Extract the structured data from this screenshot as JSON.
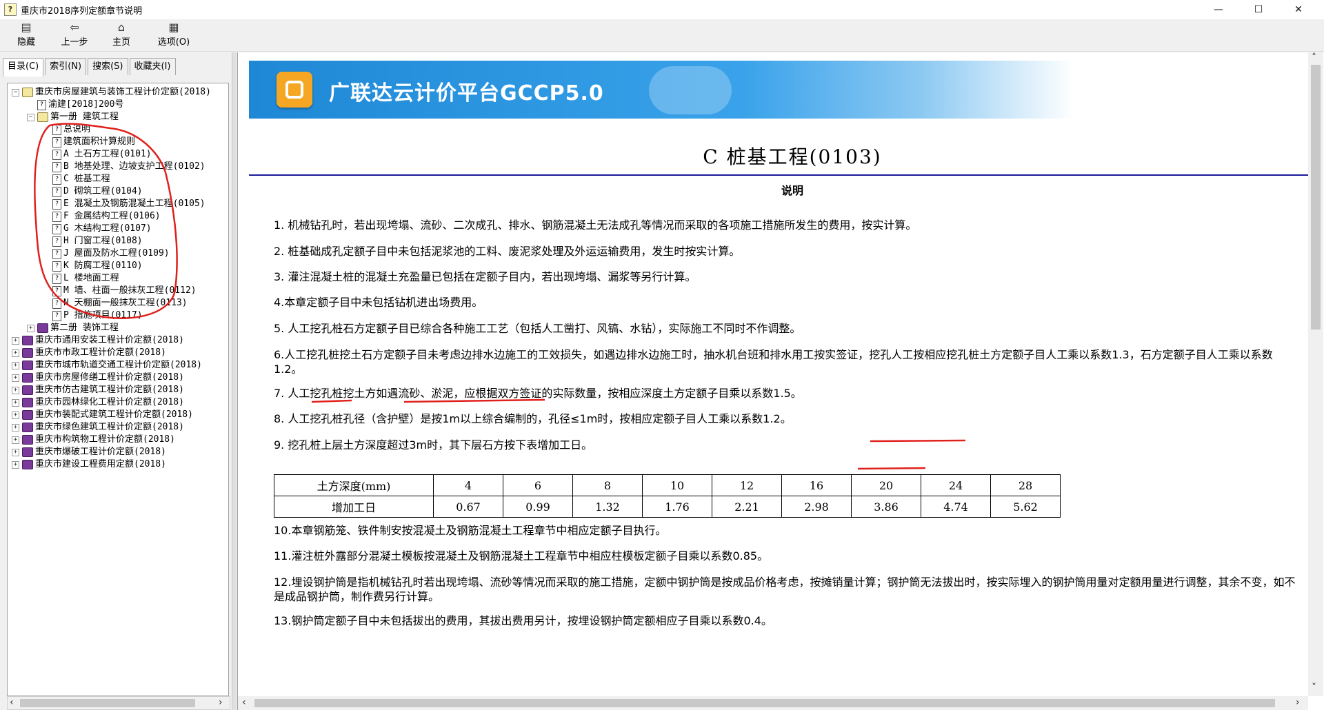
{
  "window": {
    "title": "重庆市2018序列定额章节说明",
    "controls": {
      "minimize": "—",
      "maximize": "☐",
      "close": "✕"
    }
  },
  "toolbar": {
    "hide": "隐藏",
    "back": "上一步",
    "home": "主页",
    "options": "选项(O)"
  },
  "left_tabs": [
    "目录(C)",
    "索引(N)",
    "搜索(S)",
    "收藏夹(I)"
  ],
  "tree": [
    {
      "level": 0,
      "icon": "book-open",
      "expander": "⊟",
      "label": "重庆市房屋建筑与装饰工程计价定额(2018)"
    },
    {
      "level": 1,
      "icon": "page",
      "label": "渝建[2018]200号"
    },
    {
      "level": 1,
      "icon": "book-open",
      "expander": "⊟",
      "label": "第一册 建筑工程"
    },
    {
      "level": 2,
      "icon": "page",
      "label": "总说明"
    },
    {
      "level": 2,
      "icon": "page",
      "label": "建筑面积计算规则"
    },
    {
      "level": 2,
      "icon": "page",
      "label": "A 土石方工程(0101)"
    },
    {
      "level": 2,
      "icon": "page",
      "label": "B 地基处理、边坡支护工程(0102)"
    },
    {
      "level": 2,
      "icon": "page",
      "label": "C 桩基工程"
    },
    {
      "level": 2,
      "icon": "page",
      "label": "D 砌筑工程(0104)"
    },
    {
      "level": 2,
      "icon": "page",
      "label": "E 混凝土及钢筋混凝土工程(0105)"
    },
    {
      "level": 2,
      "icon": "page",
      "label": "F 金属结构工程(0106)"
    },
    {
      "level": 2,
      "icon": "page",
      "label": "G 木结构工程(0107)"
    },
    {
      "level": 2,
      "icon": "page",
      "label": "H 门窗工程(0108)"
    },
    {
      "level": 2,
      "icon": "page",
      "label": "J 屋面及防水工程(0109)"
    },
    {
      "level": 2,
      "icon": "page",
      "label": "K 防腐工程(0110)"
    },
    {
      "level": 2,
      "icon": "page",
      "label": "L 楼地面工程"
    },
    {
      "level": 2,
      "icon": "page",
      "label": "M 墙、柱面一般抹灰工程(0112)"
    },
    {
      "level": 2,
      "icon": "page",
      "label": "N 天棚面一般抹灰工程(0113)"
    },
    {
      "level": 2,
      "icon": "page",
      "label": "P 措施项目(0117)"
    },
    {
      "level": 1,
      "icon": "book",
      "expander": "⊞",
      "label": "第二册 装饰工程"
    },
    {
      "level": 0,
      "icon": "book",
      "expander": "⊞",
      "label": "重庆市通用安装工程计价定额(2018)"
    },
    {
      "level": 0,
      "icon": "book",
      "expander": "⊞",
      "label": "重庆市市政工程计价定额(2018)"
    },
    {
      "level": 0,
      "icon": "book",
      "expander": "⊞",
      "label": "重庆市城市轨道交通工程计价定额(2018)"
    },
    {
      "level": 0,
      "icon": "book",
      "expander": "⊞",
      "label": "重庆市房屋修缮工程计价定额(2018)"
    },
    {
      "level": 0,
      "icon": "book",
      "expander": "⊞",
      "label": "重庆市仿古建筑工程计价定额(2018)"
    },
    {
      "level": 0,
      "icon": "book",
      "expander": "⊞",
      "label": "重庆市园林绿化工程计价定额(2018)"
    },
    {
      "level": 0,
      "icon": "book",
      "expander": "⊞",
      "label": "重庆市装配式建筑工程计价定额(2018)"
    },
    {
      "level": 0,
      "icon": "book",
      "expander": "⊞",
      "label": "重庆市绿色建筑工程计价定额(2018)"
    },
    {
      "level": 0,
      "icon": "book",
      "expander": "⊞",
      "label": "重庆市构筑物工程计价定额(2018)"
    },
    {
      "level": 0,
      "icon": "book",
      "expander": "⊞",
      "label": "重庆市爆破工程计价定额(2018)"
    },
    {
      "level": 0,
      "icon": "book",
      "expander": "⊞",
      "label": "重庆市建设工程费用定额(2018)"
    }
  ],
  "content": {
    "banner_text": "广联达云计价平台GCCP5.0",
    "title": "C 桩基工程(0103)",
    "subtitle": "说明",
    "paragraphs": [
      "1. 机械钻孔时，若出现垮塌、流砂、二次成孔、排水、钢筋混凝土无法成孔等情况而采取的各项施工措施所发生的费用，按实计算。",
      "2. 桩基础成孔定额子目中未包括泥浆池的工料、废泥浆处理及外运运输费用，发生时按实计算。",
      "3. 灌注混凝土桩的混凝土充盈量已包括在定额子目内，若出现垮塌、漏浆等另行计算。",
      "4.本章定额子目中未包括钻机进出场费用。",
      "5. 人工挖孔桩石方定额子目已综合各种施工工艺（包括人工凿打、风镐、水钻），实际施工不同时不作调整。",
      "6.人工挖孔桩挖土石方定额子目未考虑边排水边施工的工效损失，如遇边排水边施工时，抽水机台班和排水用工按实签证，挖孔人工按相应挖孔桩土方定额子目人工乘以系数1.3，石方定额子目人工乘以系数1.2。",
      "7. 人工挖孔桩挖土方如遇流砂、淤泥，应根据双方签证的实际数量，按相应深度土方定额子目乘以系数1.5。",
      "8. 人工挖孔桩孔径（含护壁）是按1m以上综合编制的，孔径≤1m时，按相应定额子目人工乘以系数1.2。",
      "9. 挖孔桩上层土方深度超过3m时，其下层石方按下表增加工日。",
      "10.本章钢筋笼、铁件制安按混凝土及钢筋混凝土工程章节中相应定额子目执行。",
      "11.灌注桩外露部分混凝土模板按混凝土及钢筋混凝土工程章节中相应柱模板定额子目乘以系数0.85。",
      "12.埋设钢护筒是指机械钻孔时若出现垮塌、流砂等情况而采取的施工措施，定额中钢护筒是按成品价格考虑，按摊销量计算；钢护筒无法拔出时，按实际埋入的钢护筒用量对定额用量进行调整，其余不变，如不是成品钢护筒，制作费另行计算。",
      "13.钢护筒定额子目中未包括拔出的费用，其拔出费用另计，按埋设钢护筒定额相应子目乘以系数0.4。"
    ],
    "table": {
      "header_label": "土方深度(mm)",
      "depths": [
        "4",
        "6",
        "8",
        "10",
        "12",
        "16",
        "20",
        "24",
        "28"
      ],
      "row_label": "增加工日",
      "values": [
        "0.67",
        "0.99",
        "1.32",
        "1.76",
        "2.21",
        "2.98",
        "3.86",
        "4.74",
        "5.62"
      ]
    }
  },
  "colors": {
    "banner": "#1e88d6",
    "rule": "#1a1a9a",
    "annotation": "#e0201c"
  }
}
